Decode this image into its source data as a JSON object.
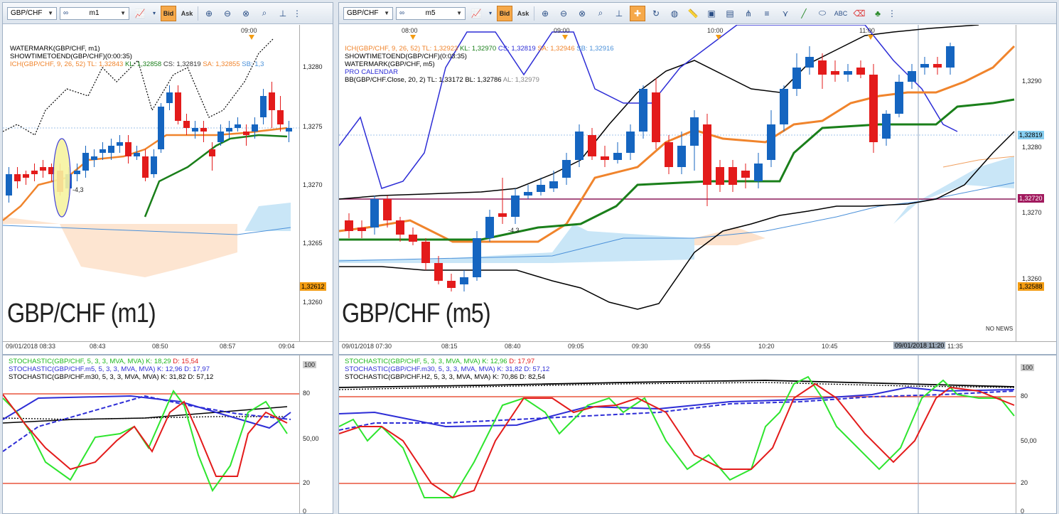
{
  "left": {
    "toolbar": {
      "symbol": "GBP/CHF",
      "timeframe": "m1",
      "bid": "Bid",
      "ask": "Ask"
    },
    "top_times": [
      "09:00"
    ],
    "legend": {
      "watermark": "WATERMARK(GBP/CHF, m1)",
      "showtime": "SHOWTIMETOEND(GBP/CHF)(0:00:35)",
      "ich_name": "ICH(GBP/CHF, 9, 26, 52)",
      "ich_tl": "TL: 1,32843",
      "ich_kl": "KL: 1,32858",
      "ich_cs": "CS: 1,32819",
      "ich_sa": "SA: 1,32855",
      "ich_sb": "SB: 1,3"
    },
    "big_watermark": "GBP/CHF (m1)",
    "prices": [
      "1,3280",
      "1,3275",
      "1,3270",
      "1,3265",
      "1,3260"
    ],
    "price_tags": {
      "current": "1,32612"
    },
    "arrow_label": "-4,3",
    "times": [
      "09/01/2018 08:33",
      "08:43",
      "08:50",
      "08:57",
      "09:04"
    ],
    "osc": {
      "l1": "STOCHASTIC(GBP/CHF, 5, 3, 3, MVA, MVA)",
      "l1k": "K: 18,29",
      "l1d": "D: 15,54",
      "l2": "STOCHASTIC(GBP/CHF.m5, 5, 3, 3, MVA, MVA)",
      "l2k": "K: 12,96",
      "l2d": "D: 17,97",
      "l3": "STOCHASTIC(GBP/CHF.m30, 5, 3, 3, MVA, MVA)",
      "l3k": "K: 31,82",
      "l3d": "D: 57,12",
      "levels": [
        "100",
        "80",
        "50,00",
        "20",
        "0"
      ]
    }
  },
  "right": {
    "toolbar": {
      "symbol": "GBP/CHF",
      "timeframe": "m5",
      "bid": "Bid",
      "ask": "Ask"
    },
    "top_times": [
      "08:00",
      "09:00",
      "10:00",
      "11:00"
    ],
    "legend": {
      "ich_name": "ICH(GBP/CHF, 9, 26, 52)",
      "ich_tl": "TL: 1,32923",
      "ich_kl": "KL: 1,32970",
      "ich_cs": "CS: 1,32819",
      "ich_sa": "SA: 1,32946",
      "ich_sb": "SB: 1,32916",
      "showtime": "SHOWTIMETOEND(GBP/CHF)(0:03:35)",
      "watermark": "WATERMARK(GBP/CHF, m5)",
      "pro": "PRO CALENDAR",
      "bb_name": "BB(GBP/CHF.Close, 20, 2)",
      "bb_tl": "TL: 1,33172",
      "bb_bl": "BL: 1,32786",
      "bb_al": "AL: 1,32979"
    },
    "big_watermark": "GBP/CHF (m5)",
    "no_news": "NO NEWS",
    "prices": [
      "1,3290",
      "1,3280",
      "1,3270",
      "1,3260"
    ],
    "price_tags": {
      "current": "1,32819",
      "line": "1,32720",
      "low": "1,32588"
    },
    "arrow_label": "-4,3",
    "times": [
      "09/01/2018 07:30",
      "08:15",
      "08:40",
      "09:05",
      "09:30",
      "09:55",
      "10:20",
      "10:45",
      "11:35"
    ],
    "cursor_time": "09/01/2018 11:20",
    "osc": {
      "l1": "STOCHASTIC(GBP/CHF, 5, 3, 3, MVA, MVA)",
      "l1k": "K: 12,96",
      "l1d": "D: 17,97",
      "l2": "STOCHASTIC(GBP/CHF.m30, 5, 3, 3, MVA, MVA)",
      "l2k": "K: 31,82",
      "l2d": "D: 57,12",
      "l3": "STOCHASTIC(GBP/CHF.H2, 5, 3, 3, MVA, MVA)",
      "l3k": "K: 70,86",
      "l3d": "D: 82,54",
      "levels": [
        "100",
        "80",
        "50,00",
        "20",
        "0"
      ]
    }
  },
  "colors": {
    "bull": "#1565c0",
    "bear": "#e31b1b",
    "kijun": "#1a7f1a",
    "tenkan": "#f0842c",
    "stochK": "#2ee52e",
    "stochD": "#e31b1b",
    "blue": "#2d2dd6"
  }
}
